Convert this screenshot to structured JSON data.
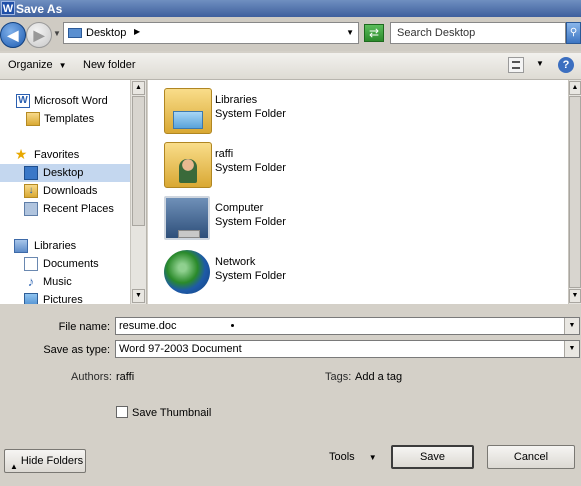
{
  "window": {
    "title": "Save As",
    "app_icon": "W"
  },
  "nav": {
    "back_glyph": "◀",
    "forward_glyph": "▶",
    "refresh_glyph": "⇄",
    "search_glyph": "⚲"
  },
  "address": {
    "location": "Desktop"
  },
  "search": {
    "placeholder": "Search Desktop"
  },
  "toolbar": {
    "organize": "Organize",
    "new_folder": "New folder"
  },
  "sidebar": {
    "items": [
      {
        "label": "Microsoft Word",
        "icon": "word-icon"
      },
      {
        "label": "Templates",
        "icon": "folder-icon"
      },
      {
        "label": "Favorites",
        "icon": "star-icon"
      },
      {
        "label": "Desktop",
        "icon": "desktop-icon",
        "selected": true
      },
      {
        "label": "Downloads",
        "icon": "downloads-icon"
      },
      {
        "label": "Recent Places",
        "icon": "recent-places-icon"
      },
      {
        "label": "Libraries",
        "icon": "libraries-icon"
      },
      {
        "label": "Documents",
        "icon": "documents-icon"
      },
      {
        "label": "Music",
        "icon": "music-icon"
      },
      {
        "label": "Pictures",
        "icon": "pictures-icon"
      }
    ]
  },
  "files": [
    {
      "name": "Libraries",
      "type": "System Folder",
      "icon": "libraries-folder-icon"
    },
    {
      "name": "raffi",
      "type": "System Folder",
      "icon": "user-folder-icon"
    },
    {
      "name": "Computer",
      "type": "System Folder",
      "icon": "computer-icon"
    },
    {
      "name": "Network",
      "type": "System Folder",
      "icon": "network-icon"
    }
  ],
  "form": {
    "file_name_label": "File name:",
    "file_name_value": "resume.doc",
    "save_type_label": "Save as type:",
    "save_type_value": "Word 97-2003 Document",
    "authors_label": "Authors:",
    "authors_value": "raffi",
    "tags_label": "Tags:",
    "tags_value": "Add a tag",
    "thumbnail_label": "Save Thumbnail"
  },
  "buttons": {
    "hide_folders": "Hide Folders",
    "tools": "Tools",
    "save": "Save",
    "cancel": "Cancel"
  },
  "colors": {
    "titlebar": "#3e5f9d",
    "selected_row": "#c4d7ef",
    "dialog_bg": "#d4d0c8"
  }
}
